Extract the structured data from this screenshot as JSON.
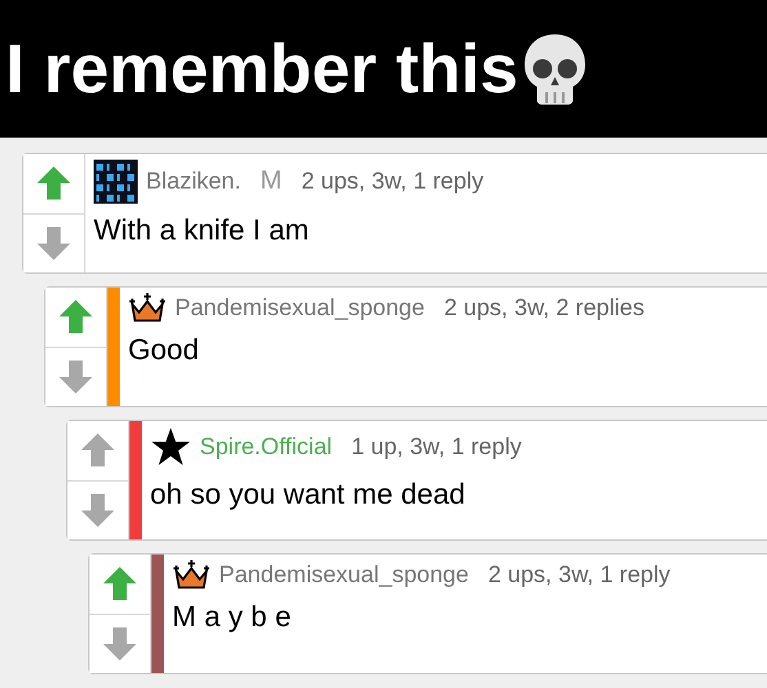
{
  "caption": {
    "text": "I remember this"
  },
  "comments": [
    {
      "kind": "avatar",
      "username": "Blaziken.",
      "mod_tag": "M",
      "meta": "2 ups, 3w, 1 reply",
      "body": "With a knife I am",
      "upvoted": true,
      "children": [
        {
          "kind": "crown",
          "username": "Pandemisexual_sponge",
          "meta": "2 ups, 3w, 2 replies",
          "body": "Good",
          "upvoted": true,
          "color": "#ff8c00",
          "children": [
            {
              "kind": "star",
              "username": "Spire.Official",
              "meta": "1 up, 3w, 1 reply",
              "body": "oh so you want me dead",
              "upvoted": false,
              "color": "#f23c3c",
              "children": [
                {
                  "kind": "crown",
                  "username": "Pandemisexual_sponge",
                  "meta": "2 ups, 3w, 1 reply",
                  "body": "M a y b e",
                  "upvoted": true,
                  "color": "#9b5555"
                }
              ]
            }
          ]
        }
      ]
    }
  ]
}
